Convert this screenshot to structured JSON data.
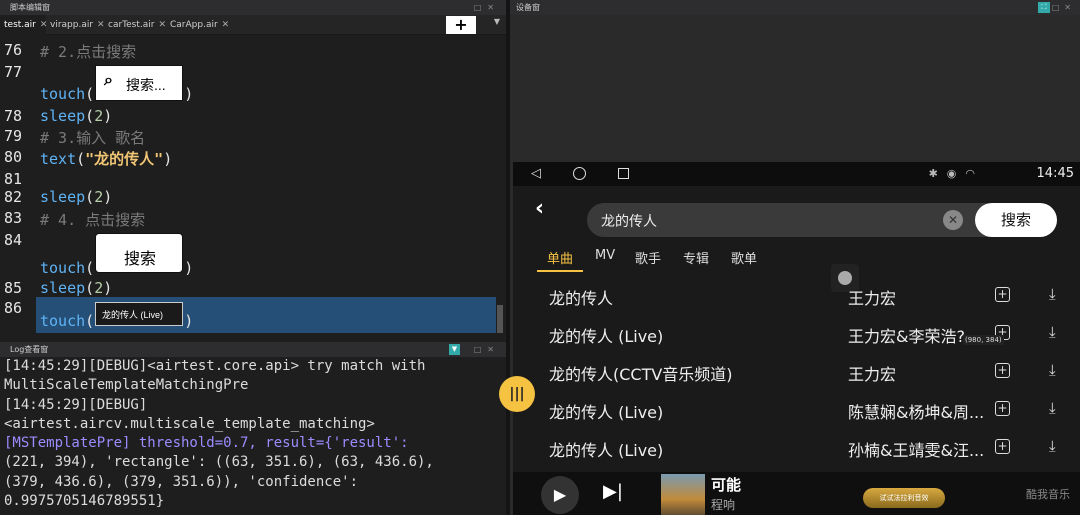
{
  "editor_panel": {
    "title": "脚本编辑窗"
  },
  "tabs": [
    {
      "label": "test.air"
    },
    {
      "label": "virapp.air"
    },
    {
      "label": "carTest.air"
    },
    {
      "label": "CarApp.air"
    }
  ],
  "tab_close": "✕",
  "plus_label": "+",
  "code": {
    "lines": [
      {
        "no": "76",
        "comment": "# 2.点击搜索"
      },
      {
        "no": "77"
      },
      {
        "no": "78",
        "fn": "sleep",
        "arg": "2"
      },
      {
        "no": "79",
        "comment": "# 3.输入 歌名"
      },
      {
        "no": "80",
        "fn": "text",
        "str": "\"龙的传人\""
      },
      {
        "no": "81"
      },
      {
        "no": "82",
        "fn": "sleep",
        "arg": "2"
      },
      {
        "no": "83",
        "comment": "# 4. 点击搜索"
      },
      {
        "no": "84"
      },
      {
        "no": "85",
        "fn": "sleep",
        "arg": "2"
      },
      {
        "no": "86"
      }
    ],
    "touch_fn": "touch",
    "thumb1_label": "搜索...",
    "thumb2_label": "搜索",
    "thumb3_label": "龙的传人 (Live)"
  },
  "log_panel": {
    "title": "Log查看窗",
    "lines": [
      "[14:45:29][DEBUG]<airtest.core.api> try match with",
      "MultiScaleTemplateMatchingPre",
      "[14:45:29][DEBUG]",
      "<airtest.aircv.multiscale_template_matching>",
      "[MSTemplatePre] threshold=0.7, result={'result':",
      "(221, 394), 'rectangle': ((63, 351.6), (63, 436.6),",
      "(379, 436.6), (379, 351.6)), 'confidence':",
      "0.9975705146789551}"
    ]
  },
  "device_panel": {
    "title": "设备窗"
  },
  "phone": {
    "time": "14:45",
    "search_query": "龙的传人",
    "search_button": "搜索",
    "categories": [
      "单曲",
      "MV",
      "歌手",
      "专辑",
      "歌单"
    ],
    "songs": [
      {
        "title": "龙的传人",
        "artist": "王力宏"
      },
      {
        "title": "龙的传人 (Live)",
        "artist": "王力宏&李荣浩?"
      },
      {
        "title": "龙的传人(CCTV音乐频道)",
        "artist": "王力宏"
      },
      {
        "title": "龙的传人 (Live)",
        "artist": "陈慧娴&杨坤&周..."
      },
      {
        "title": "龙的传人 (Live)",
        "artist": "孙楠&王靖雯&汪..."
      }
    ],
    "coord_readout": "(980, 384)",
    "now_playing": {
      "song": "可能",
      "singer": "程响"
    },
    "promo": "试试法拉利音效",
    "brand": "酷我音乐"
  },
  "colors": {
    "accent": "#f5c242",
    "highlight": "#264f78",
    "comment": "#7a7a7a",
    "keyword": "#5fb3f5",
    "string": "#f0c674"
  }
}
